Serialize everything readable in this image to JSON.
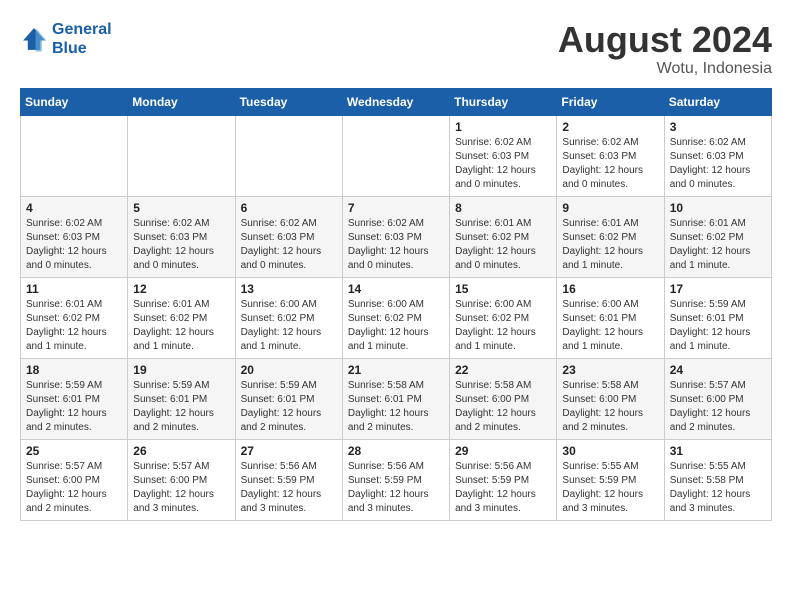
{
  "header": {
    "logo_line1": "General",
    "logo_line2": "Blue",
    "month_year": "August 2024",
    "location": "Wotu, Indonesia"
  },
  "weekdays": [
    "Sunday",
    "Monday",
    "Tuesday",
    "Wednesday",
    "Thursday",
    "Friday",
    "Saturday"
  ],
  "weeks": [
    [
      {
        "day": "",
        "sunrise": "",
        "sunset": "",
        "daylight": ""
      },
      {
        "day": "",
        "sunrise": "",
        "sunset": "",
        "daylight": ""
      },
      {
        "day": "",
        "sunrise": "",
        "sunset": "",
        "daylight": ""
      },
      {
        "day": "",
        "sunrise": "",
        "sunset": "",
        "daylight": ""
      },
      {
        "day": "1",
        "sunrise": "Sunrise: 6:02 AM",
        "sunset": "Sunset: 6:03 PM",
        "daylight": "Daylight: 12 hours and 0 minutes."
      },
      {
        "day": "2",
        "sunrise": "Sunrise: 6:02 AM",
        "sunset": "Sunset: 6:03 PM",
        "daylight": "Daylight: 12 hours and 0 minutes."
      },
      {
        "day": "3",
        "sunrise": "Sunrise: 6:02 AM",
        "sunset": "Sunset: 6:03 PM",
        "daylight": "Daylight: 12 hours and 0 minutes."
      }
    ],
    [
      {
        "day": "4",
        "sunrise": "Sunrise: 6:02 AM",
        "sunset": "Sunset: 6:03 PM",
        "daylight": "Daylight: 12 hours and 0 minutes."
      },
      {
        "day": "5",
        "sunrise": "Sunrise: 6:02 AM",
        "sunset": "Sunset: 6:03 PM",
        "daylight": "Daylight: 12 hours and 0 minutes."
      },
      {
        "day": "6",
        "sunrise": "Sunrise: 6:02 AM",
        "sunset": "Sunset: 6:03 PM",
        "daylight": "Daylight: 12 hours and 0 minutes."
      },
      {
        "day": "7",
        "sunrise": "Sunrise: 6:02 AM",
        "sunset": "Sunset: 6:03 PM",
        "daylight": "Daylight: 12 hours and 0 minutes."
      },
      {
        "day": "8",
        "sunrise": "Sunrise: 6:01 AM",
        "sunset": "Sunset: 6:02 PM",
        "daylight": "Daylight: 12 hours and 0 minutes."
      },
      {
        "day": "9",
        "sunrise": "Sunrise: 6:01 AM",
        "sunset": "Sunset: 6:02 PM",
        "daylight": "Daylight: 12 hours and 1 minute."
      },
      {
        "day": "10",
        "sunrise": "Sunrise: 6:01 AM",
        "sunset": "Sunset: 6:02 PM",
        "daylight": "Daylight: 12 hours and 1 minute."
      }
    ],
    [
      {
        "day": "11",
        "sunrise": "Sunrise: 6:01 AM",
        "sunset": "Sunset: 6:02 PM",
        "daylight": "Daylight: 12 hours and 1 minute."
      },
      {
        "day": "12",
        "sunrise": "Sunrise: 6:01 AM",
        "sunset": "Sunset: 6:02 PM",
        "daylight": "Daylight: 12 hours and 1 minute."
      },
      {
        "day": "13",
        "sunrise": "Sunrise: 6:00 AM",
        "sunset": "Sunset: 6:02 PM",
        "daylight": "Daylight: 12 hours and 1 minute."
      },
      {
        "day": "14",
        "sunrise": "Sunrise: 6:00 AM",
        "sunset": "Sunset: 6:02 PM",
        "daylight": "Daylight: 12 hours and 1 minute."
      },
      {
        "day": "15",
        "sunrise": "Sunrise: 6:00 AM",
        "sunset": "Sunset: 6:02 PM",
        "daylight": "Daylight: 12 hours and 1 minute."
      },
      {
        "day": "16",
        "sunrise": "Sunrise: 6:00 AM",
        "sunset": "Sunset: 6:01 PM",
        "daylight": "Daylight: 12 hours and 1 minute."
      },
      {
        "day": "17",
        "sunrise": "Sunrise: 5:59 AM",
        "sunset": "Sunset: 6:01 PM",
        "daylight": "Daylight: 12 hours and 1 minute."
      }
    ],
    [
      {
        "day": "18",
        "sunrise": "Sunrise: 5:59 AM",
        "sunset": "Sunset: 6:01 PM",
        "daylight": "Daylight: 12 hours and 2 minutes."
      },
      {
        "day": "19",
        "sunrise": "Sunrise: 5:59 AM",
        "sunset": "Sunset: 6:01 PM",
        "daylight": "Daylight: 12 hours and 2 minutes."
      },
      {
        "day": "20",
        "sunrise": "Sunrise: 5:59 AM",
        "sunset": "Sunset: 6:01 PM",
        "daylight": "Daylight: 12 hours and 2 minutes."
      },
      {
        "day": "21",
        "sunrise": "Sunrise: 5:58 AM",
        "sunset": "Sunset: 6:01 PM",
        "daylight": "Daylight: 12 hours and 2 minutes."
      },
      {
        "day": "22",
        "sunrise": "Sunrise: 5:58 AM",
        "sunset": "Sunset: 6:00 PM",
        "daylight": "Daylight: 12 hours and 2 minutes."
      },
      {
        "day": "23",
        "sunrise": "Sunrise: 5:58 AM",
        "sunset": "Sunset: 6:00 PM",
        "daylight": "Daylight: 12 hours and 2 minutes."
      },
      {
        "day": "24",
        "sunrise": "Sunrise: 5:57 AM",
        "sunset": "Sunset: 6:00 PM",
        "daylight": "Daylight: 12 hours and 2 minutes."
      }
    ],
    [
      {
        "day": "25",
        "sunrise": "Sunrise: 5:57 AM",
        "sunset": "Sunset: 6:00 PM",
        "daylight": "Daylight: 12 hours and 2 minutes."
      },
      {
        "day": "26",
        "sunrise": "Sunrise: 5:57 AM",
        "sunset": "Sunset: 6:00 PM",
        "daylight": "Daylight: 12 hours and 3 minutes."
      },
      {
        "day": "27",
        "sunrise": "Sunrise: 5:56 AM",
        "sunset": "Sunset: 5:59 PM",
        "daylight": "Daylight: 12 hours and 3 minutes."
      },
      {
        "day": "28",
        "sunrise": "Sunrise: 5:56 AM",
        "sunset": "Sunset: 5:59 PM",
        "daylight": "Daylight: 12 hours and 3 minutes."
      },
      {
        "day": "29",
        "sunrise": "Sunrise: 5:56 AM",
        "sunset": "Sunset: 5:59 PM",
        "daylight": "Daylight: 12 hours and 3 minutes."
      },
      {
        "day": "30",
        "sunrise": "Sunrise: 5:55 AM",
        "sunset": "Sunset: 5:59 PM",
        "daylight": "Daylight: 12 hours and 3 minutes."
      },
      {
        "day": "31",
        "sunrise": "Sunrise: 5:55 AM",
        "sunset": "Sunset: 5:58 PM",
        "daylight": "Daylight: 12 hours and 3 minutes."
      }
    ]
  ]
}
